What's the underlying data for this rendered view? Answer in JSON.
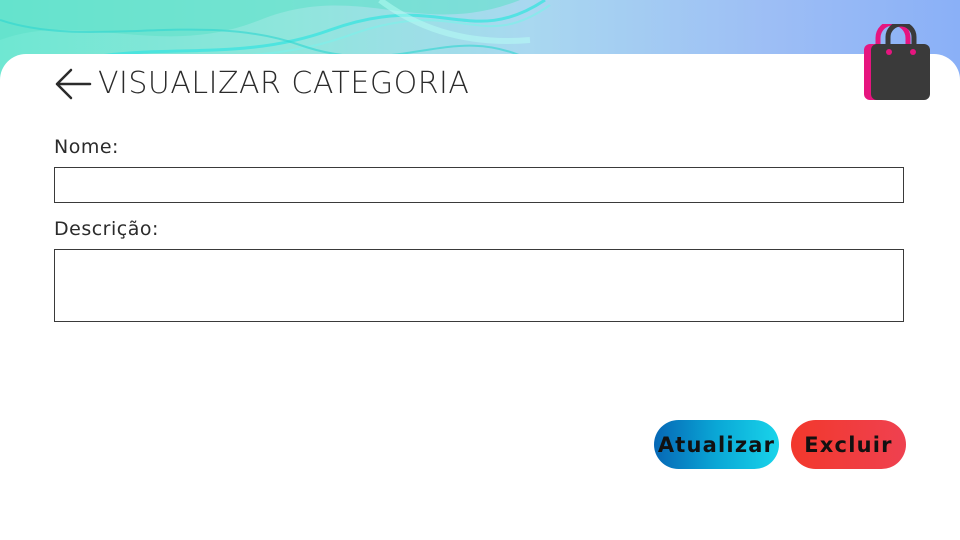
{
  "header": {
    "title": "VISUALIZAR CATEGORIA"
  },
  "form": {
    "name_label": "Nome:",
    "name_value": "",
    "description_label": "Descrição:",
    "description_value": ""
  },
  "actions": {
    "update_label": "Atualizar",
    "delete_label": "Excluir"
  },
  "icons": {
    "back": "arrow-left-icon",
    "bag": "shopping-bag-icon"
  },
  "colors": {
    "update_gradient": [
      "#0667b5",
      "#19d4ea"
    ],
    "delete_gradient": [
      "#f2382c",
      "#ef4150"
    ],
    "bag_dark": "#3a3a3a",
    "bag_accent": "#e6157f"
  }
}
